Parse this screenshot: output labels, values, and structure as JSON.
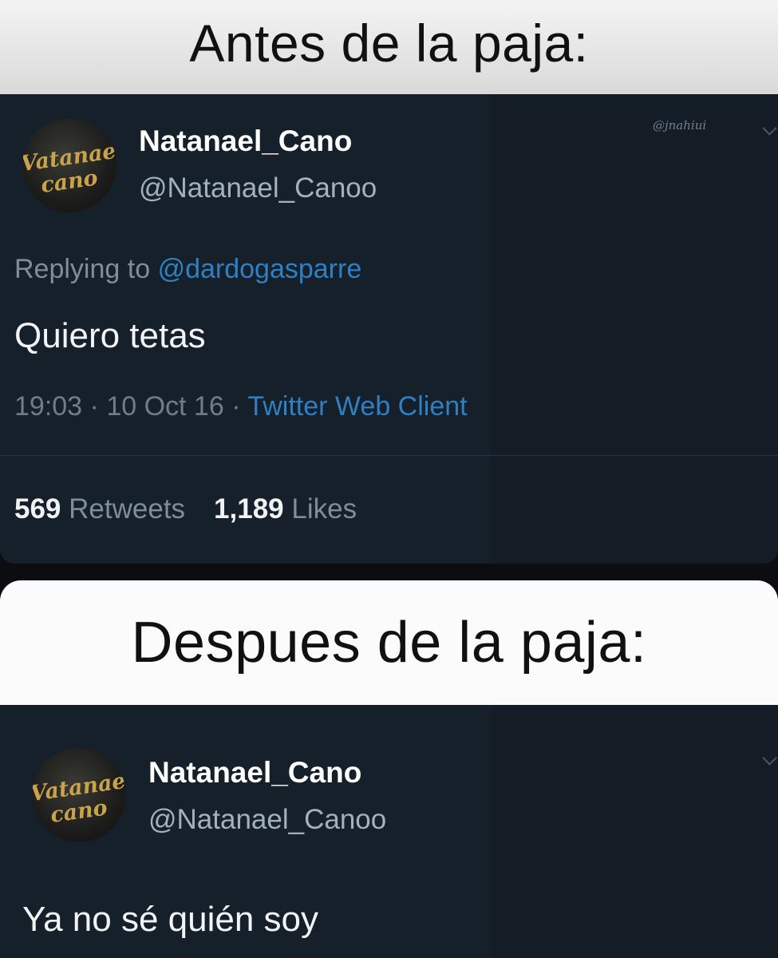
{
  "captions": {
    "before": "Antes de la paja:",
    "after": "Despues de la paja:"
  },
  "watermark": "@jnahiui",
  "tweet1": {
    "display_name": "Natanael_Cano",
    "handle": "@Natanael_Canoo",
    "replying_prefix": "Replying to",
    "replying_to": "@dardogasparre",
    "text": "Quiero tetas",
    "time": "19:03",
    "date": "10 Oct 16",
    "client": "Twitter Web Client",
    "retweets_count": "569",
    "retweets_label": "Retweets",
    "likes_count": "1,189",
    "likes_label": "Likes"
  },
  "tweet2": {
    "display_name": "Natanael_Cano",
    "handle": "@Natanael_Canoo",
    "text": "Ya no sé quién soy"
  },
  "avatar": {
    "logo_text": "Natanael Cano",
    "logo_color": "#c9a24a",
    "icon": "natanael-cano-logo"
  },
  "colors": {
    "tweet_bg": "#15202b",
    "link_blue": "#2f7fc3"
  }
}
